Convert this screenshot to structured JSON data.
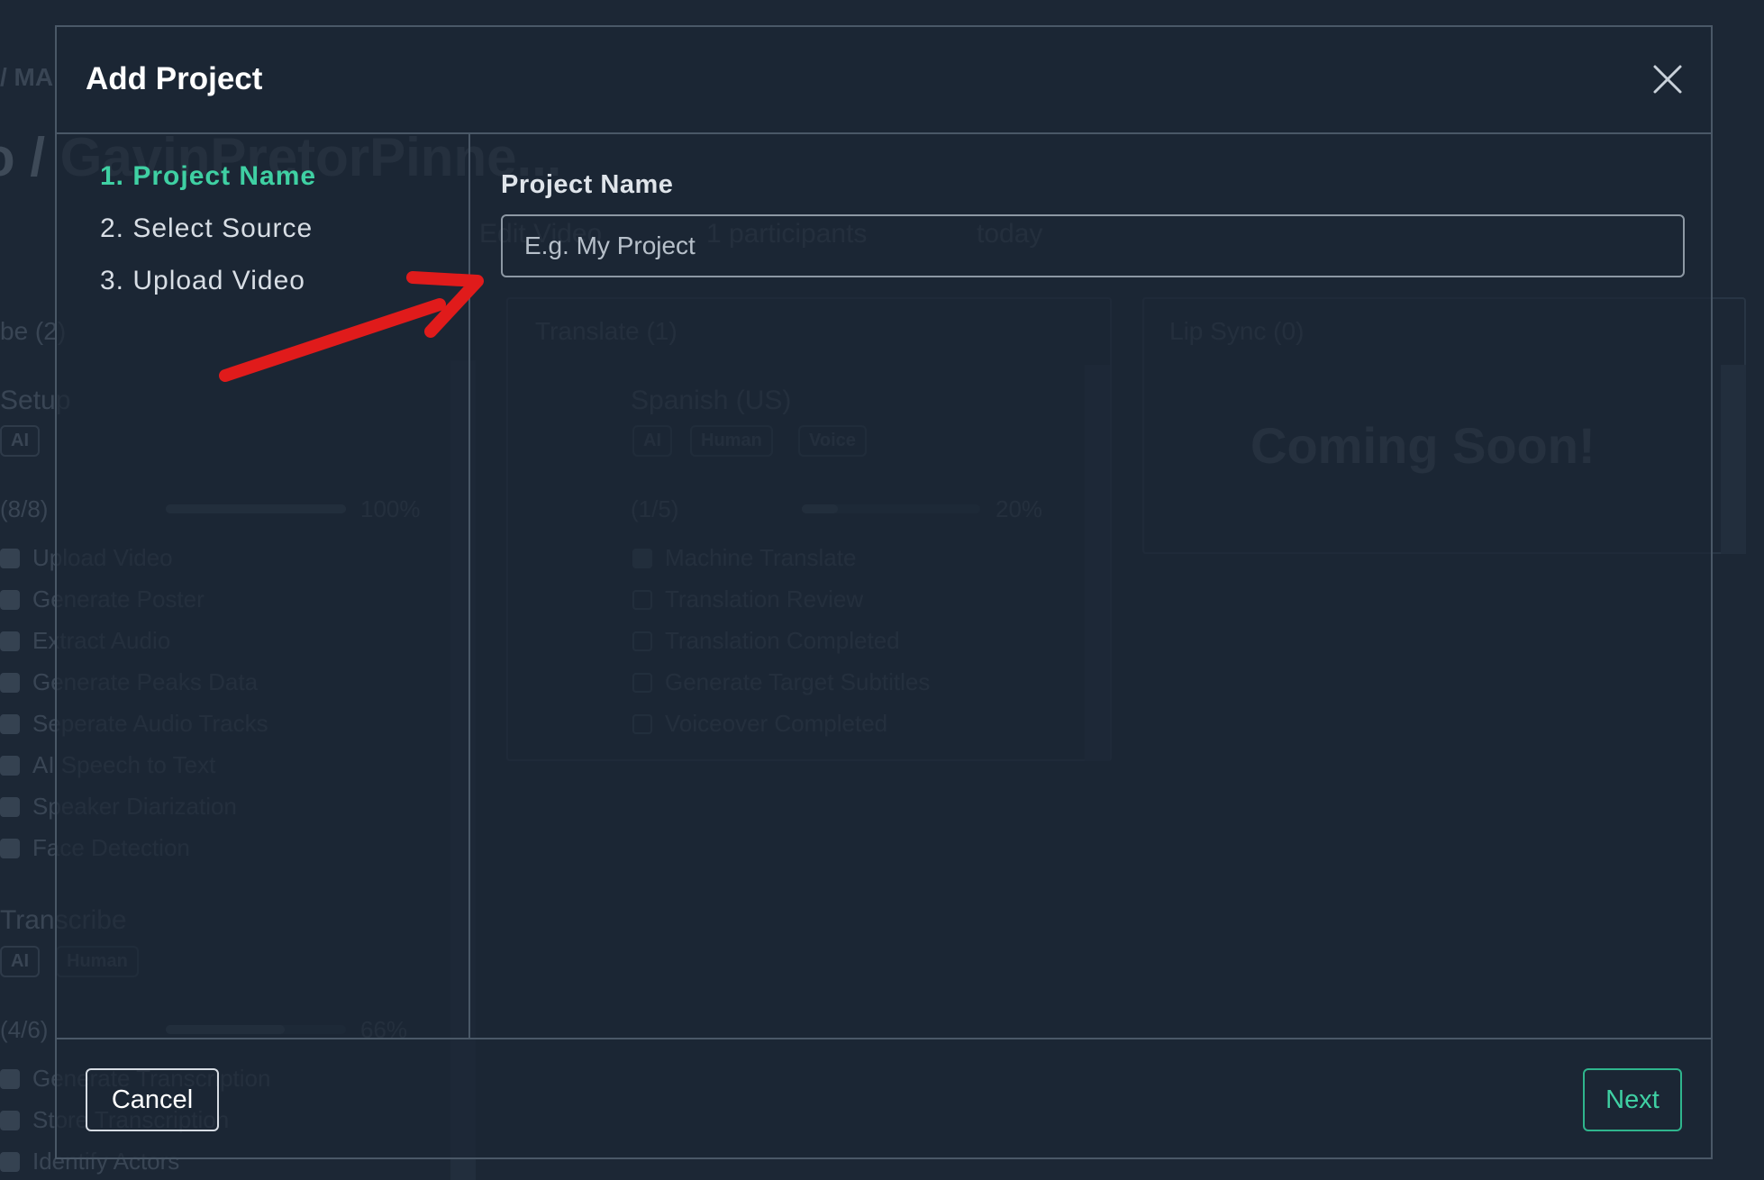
{
  "background": {
    "breadcrumb": "/ MA",
    "title": "o / GavinPretorPinne...",
    "toolbar": {
      "edit_label": "Edit Video",
      "participants": "1 participants",
      "date": "today"
    },
    "left_column": {
      "header": "be (2)",
      "setup": {
        "title": "Setup",
        "chips": [
          "AI"
        ],
        "progress_label": "(8/8)",
        "progress_percent": 100,
        "progress_text": "100%",
        "tasks": [
          {
            "label": "Upload Video",
            "done": true
          },
          {
            "label": "Generate Poster",
            "done": true
          },
          {
            "label": "Extract Audio",
            "done": true
          },
          {
            "label": "Generate Peaks Data",
            "done": true
          },
          {
            "label": "Seperate Audio Tracks",
            "done": true
          },
          {
            "label": "AI Speech to Text",
            "done": true
          },
          {
            "label": "Speaker Diarization",
            "done": true
          },
          {
            "label": "Face Detection",
            "done": true
          }
        ]
      },
      "transcribe": {
        "title": "Transcribe",
        "chips": [
          "AI",
          "Human"
        ],
        "progress_label": "(4/6)",
        "progress_percent": 66,
        "progress_text": "66%",
        "tasks": [
          {
            "label": "Generate Transcription",
            "done": true
          },
          {
            "label": "Store Transcription",
            "done": true
          },
          {
            "label": "Identify Actors",
            "done": true
          }
        ]
      }
    },
    "translate_panel": {
      "title": "Translate (1)",
      "language": "Spanish (US)",
      "chips": [
        "AI",
        "Human",
        "Voice"
      ],
      "progress_label": "(1/5)",
      "progress_percent": 20,
      "progress_text": "20%",
      "tasks": [
        {
          "label": "Machine Translate",
          "done": true
        },
        {
          "label": "Translation Review",
          "done": false
        },
        {
          "label": "Translation Completed",
          "done": false
        },
        {
          "label": "Generate Target Subtitles",
          "done": false
        },
        {
          "label": "Voiceover Completed",
          "done": false
        }
      ]
    },
    "lipsync_panel": {
      "title": "Lip Sync (0)",
      "message": "Coming Soon!"
    }
  },
  "modal": {
    "title": "Add Project",
    "steps": [
      "1. Project Name",
      "2. Select Source",
      "3. Upload Video"
    ],
    "active_step": 0,
    "field": {
      "label": "Project Name",
      "value": "",
      "placeholder": "E.g. My Project"
    },
    "cancel_label": "Cancel",
    "next_label": "Next"
  },
  "colors": {
    "accent": "#3fd0a3",
    "background": "#1c2735",
    "annotation_arrow": "#e01b1b"
  },
  "icons": {
    "close": "close-icon"
  }
}
